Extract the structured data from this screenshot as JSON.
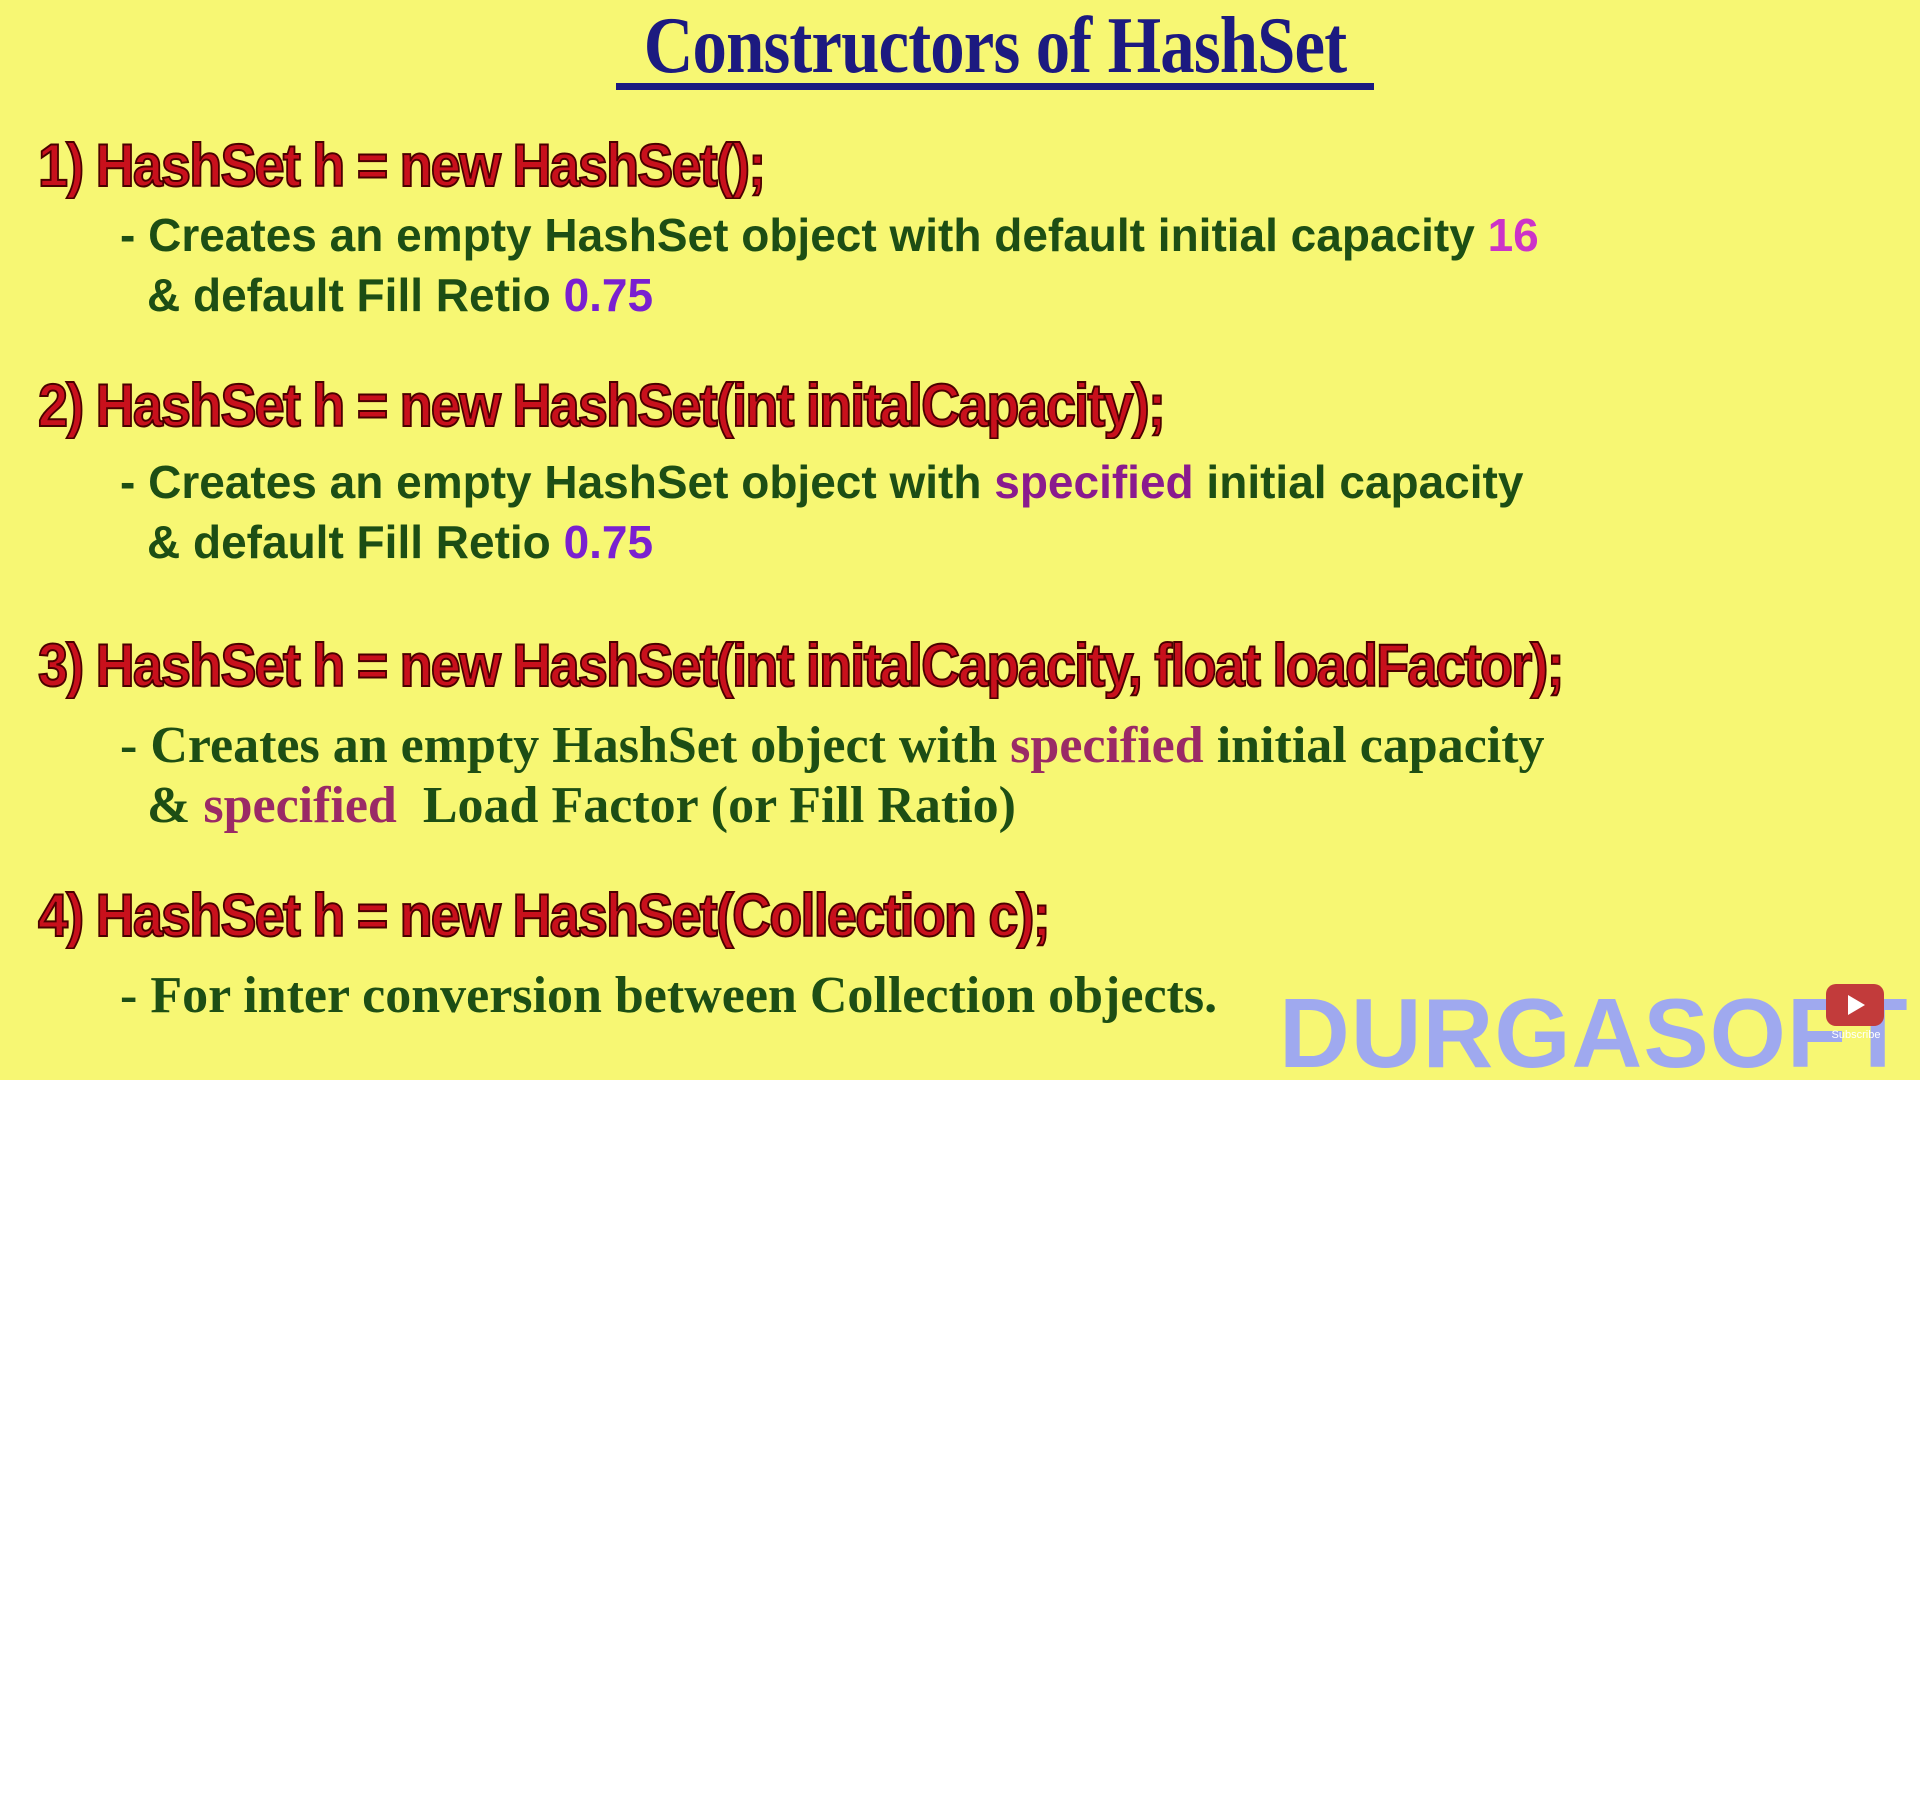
{
  "title": "Constructors of HashSet",
  "constructors": [
    {
      "signature": "1) HashSet h = new HashSet();",
      "line1": {
        "text": "- Creates an empty HashSet object with default initial capacity ",
        "highlight": "16"
      },
      "line2": {
        "text": "& default Fill Retio ",
        "highlight": "0.75"
      }
    },
    {
      "signature": "2) HashSet h = new HashSet(int initalCapacity);",
      "line1": {
        "before": "- Creates an empty HashSet object with ",
        "highlight": "specified",
        "after": " initial capacity"
      },
      "line2": {
        "text": "& default Fill Retio ",
        "highlight": "0.75"
      }
    },
    {
      "signature": "3) HashSet h = new HashSet(int initalCapacity, float loadFactor);",
      "line1": {
        "before": "- Creates an empty HashSet object with ",
        "highlight": "specified",
        "after": " initial capacity"
      },
      "line2": {
        "before": "& ",
        "highlight": "specified",
        "after": "  Load Factor (or Fill Ratio)"
      }
    },
    {
      "signature": "4) HashSet h = new HashSet(Collection c);",
      "line1": {
        "text": "- For inter conversion between Collection objects."
      }
    }
  ],
  "watermark": "DURGASOFT",
  "youtube_badge": {
    "icon": "play-icon",
    "caption": "Subscribe"
  },
  "colors": {
    "background": "#f7f773",
    "title": "#1c1a80",
    "signature": "#c8101c",
    "description": "#1d4e14",
    "watermark": "#9fa9ef"
  }
}
